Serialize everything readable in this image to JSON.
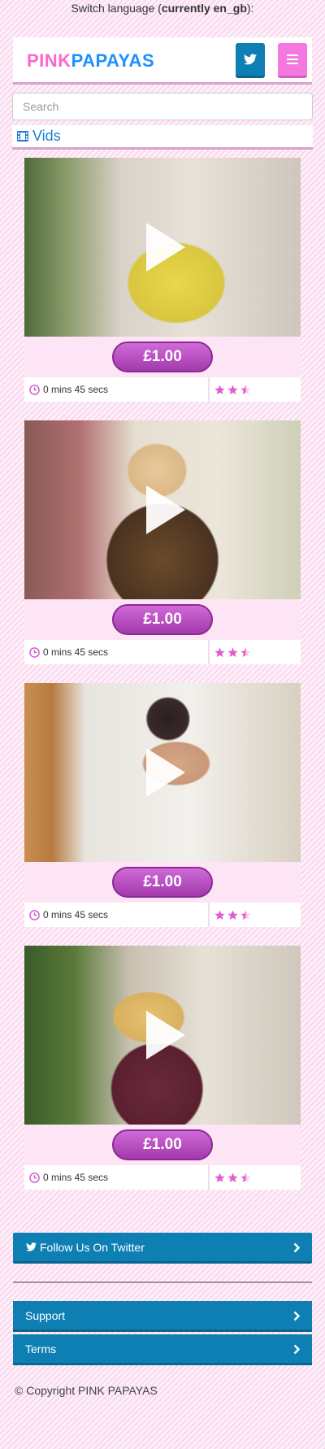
{
  "lang_bar": {
    "prefix": "Switch language (",
    "current": "currently en_gb",
    "suffix": "):"
  },
  "header": {
    "logo_part1": "PINK",
    "logo_part2": "PAPAYAS"
  },
  "search": {
    "placeholder": "Search"
  },
  "section": {
    "title": "Vids",
    "icon": "film-icon"
  },
  "videos": [
    {
      "price": "£1.00",
      "duration": "0 mins 45 secs",
      "rating": 2.5
    },
    {
      "price": "£1.00",
      "duration": "0 mins 45 secs",
      "rating": 2.5
    },
    {
      "price": "£1.00",
      "duration": "0 mins 45 secs",
      "rating": 2.5
    },
    {
      "price": "£1.00",
      "duration": "0 mins 45 secs",
      "rating": 2.5
    }
  ],
  "footer": {
    "follow_label": "Follow Us On Twitter",
    "support_label": "Support",
    "terms_label": "Terms",
    "copyright": "© Copyright PINK PAPAYAS"
  },
  "colors": {
    "accent_pink": "#ff66cc",
    "brand_blue": "#1e90ff",
    "twitter_blue": "#0e7fb3",
    "price_purple": "#b54abf",
    "star_pink": "#e05fd0"
  }
}
